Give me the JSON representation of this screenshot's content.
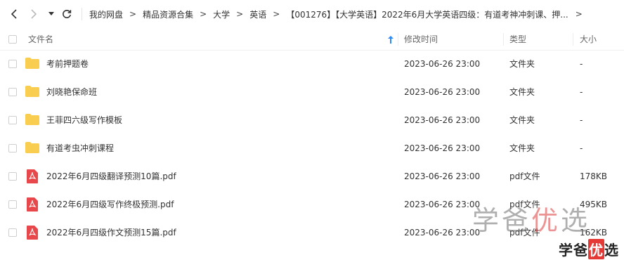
{
  "breadcrumb": [
    "我的网盘",
    "精品资源合集",
    "大学",
    "英语",
    "【001276】【大学英语】2022年6月大学英语四级：有道考神冲刺课、押..."
  ],
  "breadcrumb_separator": ">",
  "breadcrumb_more": ">",
  "columns": {
    "name": "文件名",
    "modified": "修改时间",
    "type": "类型",
    "size": "大小"
  },
  "files": [
    {
      "name": "考前押题卷",
      "modified": "2023-06-26 23:00",
      "type": "文件夹",
      "size": "-",
      "icon": "folder-icon"
    },
    {
      "name": "刘晓艳保命班",
      "modified": "2023-06-26 23:00",
      "type": "文件夹",
      "size": "-",
      "icon": "folder-icon"
    },
    {
      "name": "王菲四六级写作模板",
      "modified": "2023-06-26 23:00",
      "type": "文件夹",
      "size": "-",
      "icon": "folder-icon"
    },
    {
      "name": "有道考虫冲刺课程",
      "modified": "2023-06-26 23:00",
      "type": "文件夹",
      "size": "-",
      "icon": "folder-icon"
    },
    {
      "name": "2022年6月四级翻译预测10篇.pdf",
      "modified": "2023-06-26 23:00",
      "type": "pdf文件",
      "size": "178KB",
      "icon": "pdf-icon"
    },
    {
      "name": "2022年6月四级写作终极预测.pdf",
      "modified": "2023-06-26 23:00",
      "type": "pdf文件",
      "size": "495KB",
      "icon": "pdf-icon"
    },
    {
      "name": "2022年6月四级作文预测15篇.pdf",
      "modified": "2023-06-26 23:00",
      "type": "pdf文件",
      "size": "162KB",
      "icon": "pdf-icon"
    }
  ],
  "watermark": {
    "text_a": "学爸",
    "text_b": "优",
    "text_c": "选"
  },
  "colors": {
    "folder": "#f9cd4f",
    "pdf": "#e8484c",
    "sort_arrow": "#2b8af7"
  }
}
